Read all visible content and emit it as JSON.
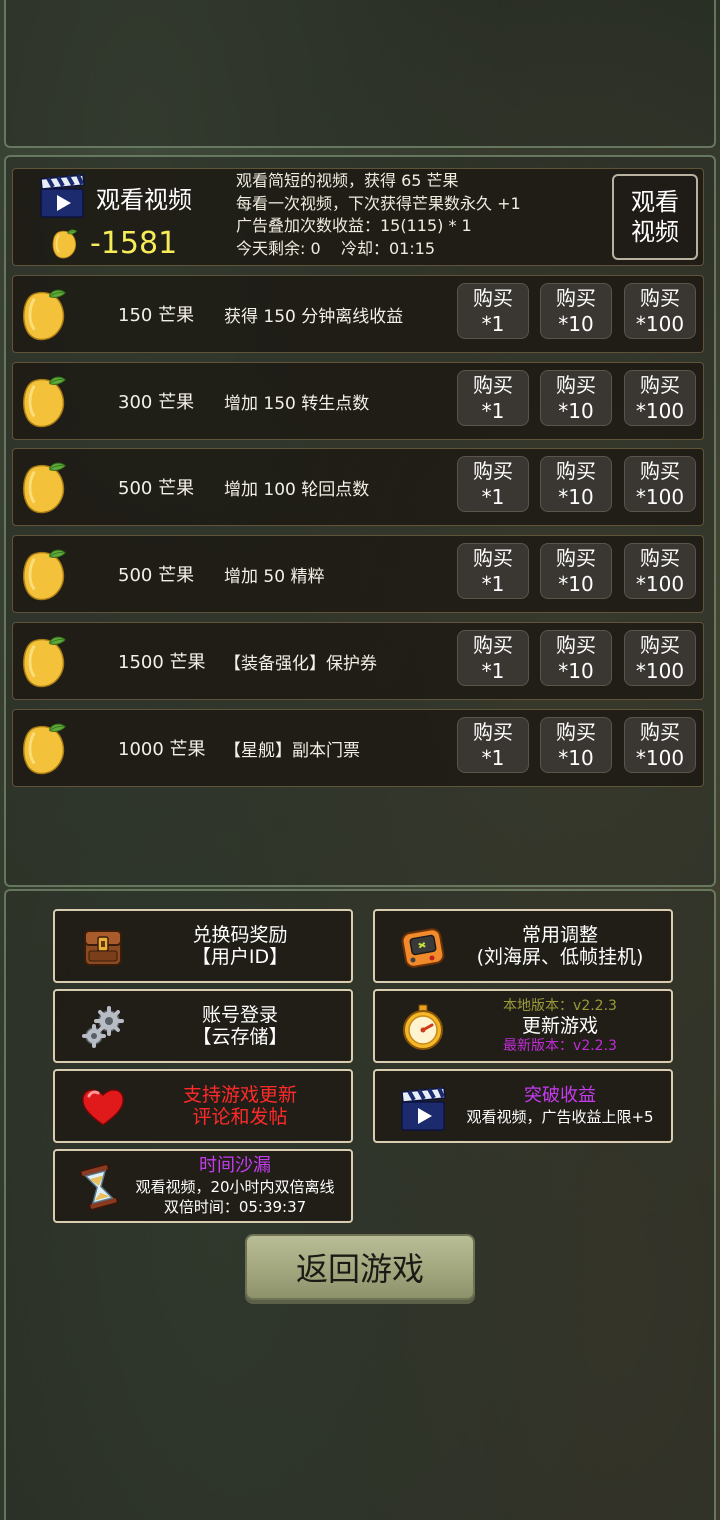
{
  "video_section": {
    "title": "观看视频",
    "mango_count": "-1581",
    "desc_lines": [
      "观看简短的视频，获得 65 芒果",
      "每看一次视频，下次获得芒果数永久 +1",
      "广告叠加次数收益：15(115) * 1",
      "今天剩余: 0    冷却：01:15"
    ],
    "watch_button": "观看\n视频"
  },
  "shop_items": [
    {
      "price": "150 芒果",
      "desc": "获得 150 分钟离线收益"
    },
    {
      "price": "300 芒果",
      "desc": "增加 150 转生点数"
    },
    {
      "price": "500 芒果",
      "desc": "增加 100 轮回点数"
    },
    {
      "price": "500 芒果",
      "desc": "增加 50 精粹"
    },
    {
      "price": "1500 芒果",
      "desc": "【装备强化】保护券"
    },
    {
      "price": "1000 芒果",
      "desc": "【星舰】副本门票"
    }
  ],
  "buy_buttons": {
    "top": "购买",
    "x1": "*1",
    "x10": "*10",
    "x100": "*100"
  },
  "menu": {
    "redeem": {
      "line1": "兑换码奖励",
      "line2": "【用户ID】"
    },
    "settings": {
      "line1": "常用调整",
      "line2": "(刘海屏、低帧挂机)"
    },
    "account": {
      "line1": "账号登录",
      "line2": "【云存储】"
    },
    "update": {
      "local": "本地版本：v2.2.3",
      "title": "更新游戏",
      "latest": "最新版本：v2.2.3"
    },
    "support": {
      "line1": "支持游戏更新",
      "line2": "评论和发帖"
    },
    "breakthrough": {
      "title": "突破收益",
      "desc": "观看视频，广告收益上限+5"
    },
    "hourglass": {
      "title": "时间沙漏",
      "desc": "观看视频，20小时内双倍离线",
      "time": "双倍时间：05:39:37"
    }
  },
  "return_button": "返回游戏",
  "colors": {
    "gold": "#f6ec5a",
    "red": "#ff2a2a",
    "purple": "#c63cf0",
    "olive": "#9a9a3a",
    "panel_border": "#d9ccb0"
  },
  "icons": [
    "clapperboard-icon",
    "mango-icon",
    "backpack-icon",
    "gameboy-icon",
    "gears-icon",
    "stopwatch-icon",
    "heart-icon",
    "hourglass-icon"
  ]
}
